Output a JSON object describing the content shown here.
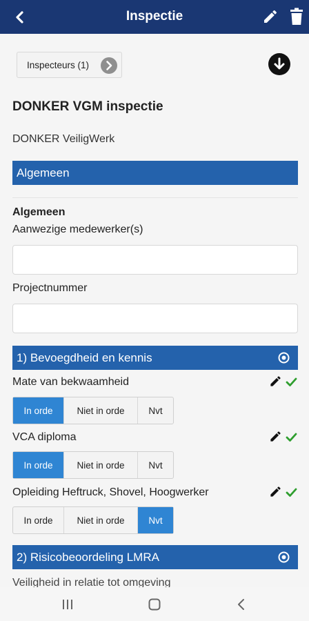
{
  "appbar": {
    "title": "Inspectie",
    "back_icon": "back-chevron-icon",
    "edit_icon": "pencil-icon",
    "delete_icon": "trash-icon"
  },
  "inspecteurs_button": "Inspecteurs (1)",
  "page": {
    "title": "DONKER VGM inspectie",
    "subtitle": "DONKER VeiligWerk"
  },
  "section_general": {
    "title": "Algemeen",
    "heading": "Algemeen",
    "fields": [
      {
        "label": "Aanwezige medewerker(s)",
        "value": "",
        "placeholder": ""
      },
      {
        "label": "Projectnummer",
        "value": "",
        "placeholder": ""
      }
    ]
  },
  "section1": {
    "title": "1) Bevoegdheid en kennis",
    "questions": [
      {
        "label": "Mate van bekwaamheid",
        "options": [
          "In orde",
          "Niet in orde",
          "Nvt"
        ],
        "selected": "In orde"
      },
      {
        "label": "VCA diploma",
        "options": [
          "In orde",
          "Niet in orde",
          "Nvt"
        ],
        "selected": "In orde"
      },
      {
        "label": "Opleiding Heftruck, Shovel, Hoogwerker",
        "options": [
          "In orde",
          "Niet in orde",
          "Nvt"
        ],
        "selected": "Nvt"
      }
    ]
  },
  "section2": {
    "title": "2) Risicobeoordeling LMRA",
    "first_question_partial": "Veiligheid in relatie tot omgeving"
  },
  "colors": {
    "appbar": "#1a3773",
    "section": "#2462ac",
    "selected": "#2f85d3",
    "check": "#2e9e2e"
  }
}
